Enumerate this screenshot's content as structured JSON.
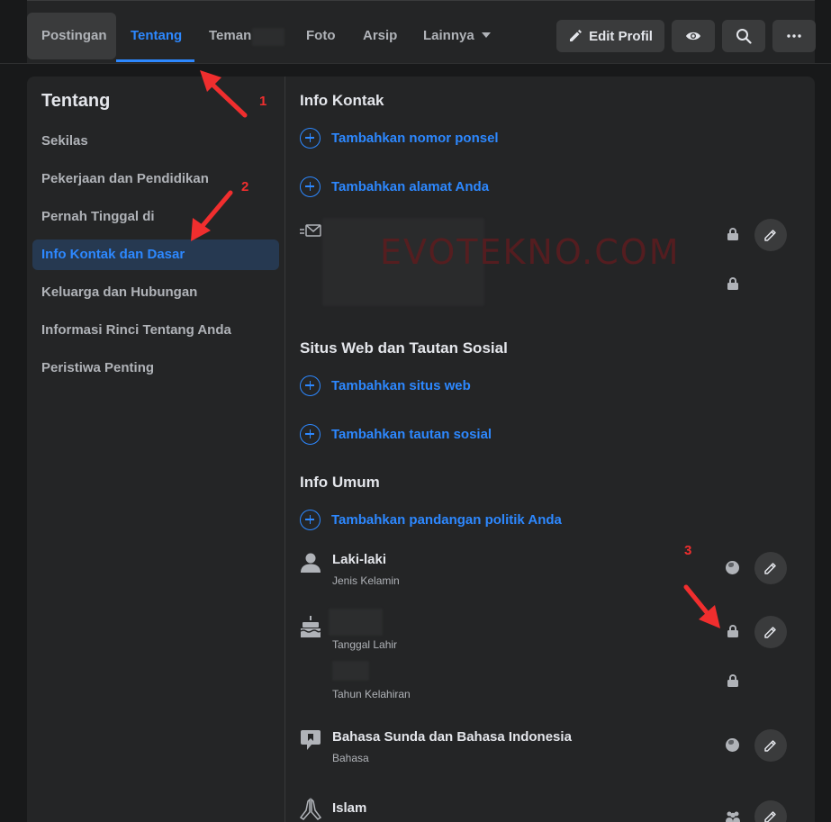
{
  "tabs": [
    {
      "label": "Postingan"
    },
    {
      "label": "Tentang"
    },
    {
      "label": "Teman"
    },
    {
      "label": "Foto"
    },
    {
      "label": "Arsip"
    },
    {
      "label": "Lainnya"
    }
  ],
  "actions": {
    "edit_profile": "Edit Profil",
    "view_icon": "eye-icon",
    "search_icon": "search-icon",
    "more_icon": "more-icon"
  },
  "sidebar": {
    "title": "Tentang",
    "items": [
      {
        "label": "Sekilas"
      },
      {
        "label": "Pekerjaan dan Pendidikan"
      },
      {
        "label": "Pernah Tinggal di"
      },
      {
        "label": "Info Kontak dan Dasar"
      },
      {
        "label": "Keluarga dan Hubungan"
      },
      {
        "label": "Informasi Rinci Tentang Anda"
      },
      {
        "label": "Peristiwa Penting"
      }
    ]
  },
  "contact": {
    "title": "Info Kontak",
    "add_phone": "Tambahkan nomor ponsel",
    "add_address": "Tambahkan alamat Anda"
  },
  "websites": {
    "title": "Situs Web dan Tautan Sosial",
    "add_website": "Tambahkan situs web",
    "add_social": "Tambahkan tautan sosial"
  },
  "general": {
    "title": "Info Umum",
    "add_politics": "Tambahkan pandangan politik Anda",
    "gender_value": "Laki-laki",
    "gender_label": "Jenis Kelamin",
    "birthdate_label": "Tanggal Lahir",
    "birthyear_label": "Tahun Kelahiran",
    "language_value": "Bahasa Sunda dan Bahasa Indonesia",
    "language_label": "Bahasa",
    "religion_value": "Islam"
  },
  "watermark": "EVOTEKNO.COM",
  "annotations": [
    "1",
    "2",
    "3"
  ],
  "colors": {
    "accent": "#2d88ff",
    "background": "#18191a",
    "surface": "#242526",
    "annotation": "#f02e2e"
  }
}
